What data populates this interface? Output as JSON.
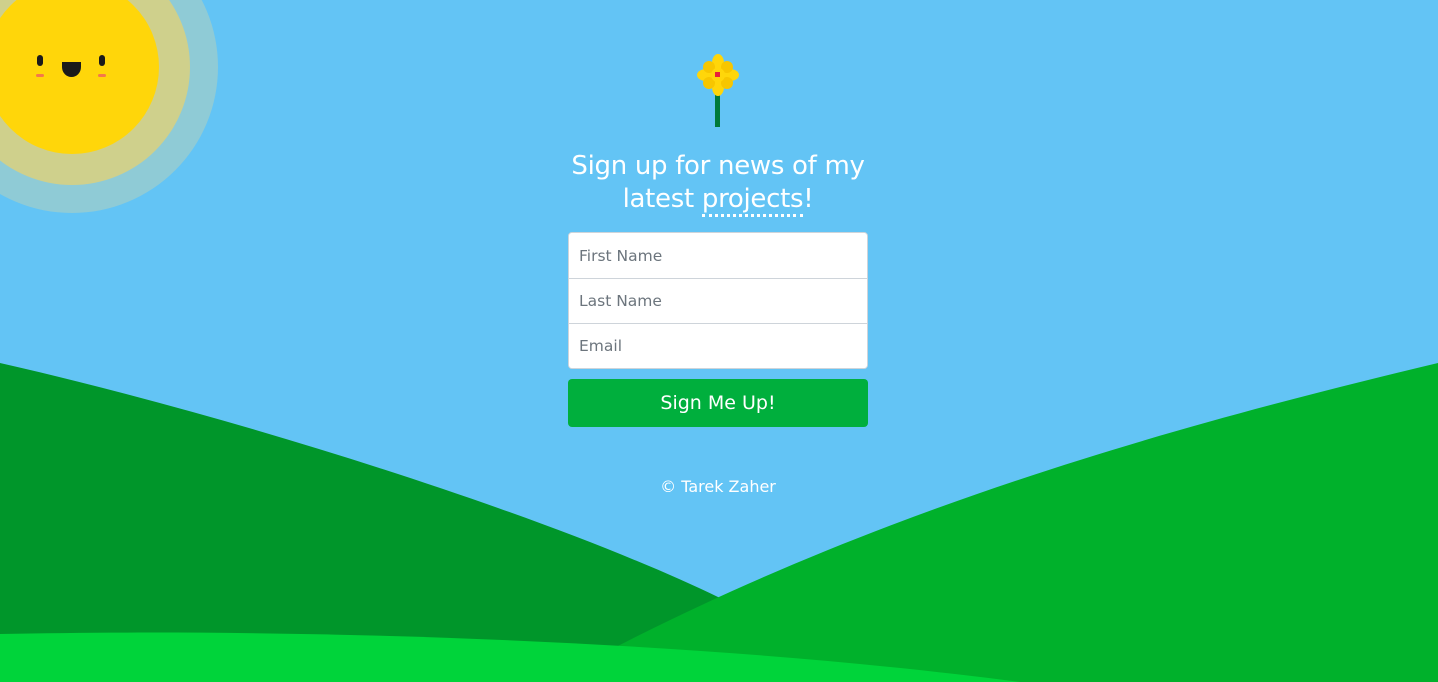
{
  "signup": {
    "heading_prefix": "Sign up for news of my latest ",
    "heading_highlight": "projects",
    "heading_suffix": "!",
    "first_name_placeholder": "First Name",
    "last_name_placeholder": "Last Name",
    "email_placeholder": "Email",
    "submit_label": "Sign Me Up!"
  },
  "footer": {
    "copyright": "© Tarek Zaher"
  },
  "colors": {
    "sky": "#63c4f5",
    "sun": "#ffd60a",
    "hill_left": "#00962a",
    "hill_right": "#00b12b",
    "hill_front": "#00d43a",
    "button": "#00af3d"
  },
  "icons": {
    "sun": "smiling-sun-icon",
    "flower": "yellow-flower-icon"
  }
}
